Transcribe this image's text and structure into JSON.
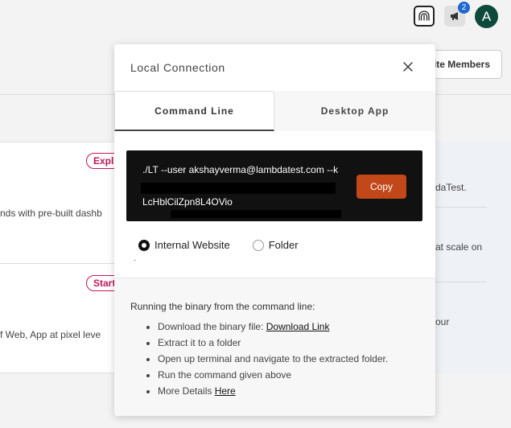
{
  "topbar": {
    "connection_icon": "fingerprint-tunnel-icon",
    "announcement_icon": "megaphone-icon",
    "announcement_badge": "2",
    "avatar_initial": "A"
  },
  "background": {
    "invite_button_label": "ite Members",
    "left_cards": [
      {
        "pill": "Expl",
        "text": "nds with pre-built dashb"
      },
      {
        "pill": "Start",
        "text": "f Web, App at pixel leve"
      }
    ],
    "right_texts": [
      "daTest.",
      "at scale on",
      "our"
    ]
  },
  "modal": {
    "title": "Local Connection",
    "close_icon": "close-icon",
    "tabs": [
      {
        "label": "Command Line",
        "active": true
      },
      {
        "label": "Desktop App",
        "active": false
      }
    ],
    "command": {
      "line1": "./LT --user akshayverma@lambdatest.com --k",
      "line3": "LcHblCilZpn8L4OVio",
      "copy_label": "Copy"
    },
    "radio_options": [
      {
        "label": "Internal Website",
        "checked": true
      },
      {
        "label": "Folder",
        "checked": false
      }
    ],
    "info": {
      "title": "Running the binary from the command line:",
      "steps": [
        {
          "text": "Download the binary file: ",
          "link": "Download Link"
        },
        {
          "text": "Extract it to a folder",
          "link": ""
        },
        {
          "text": "Open up terminal and navigate to the extracted folder.",
          "link": ""
        },
        {
          "text": "Run the command given above",
          "link": ""
        },
        {
          "text": "More Details ",
          "link": "Here"
        }
      ]
    }
  }
}
